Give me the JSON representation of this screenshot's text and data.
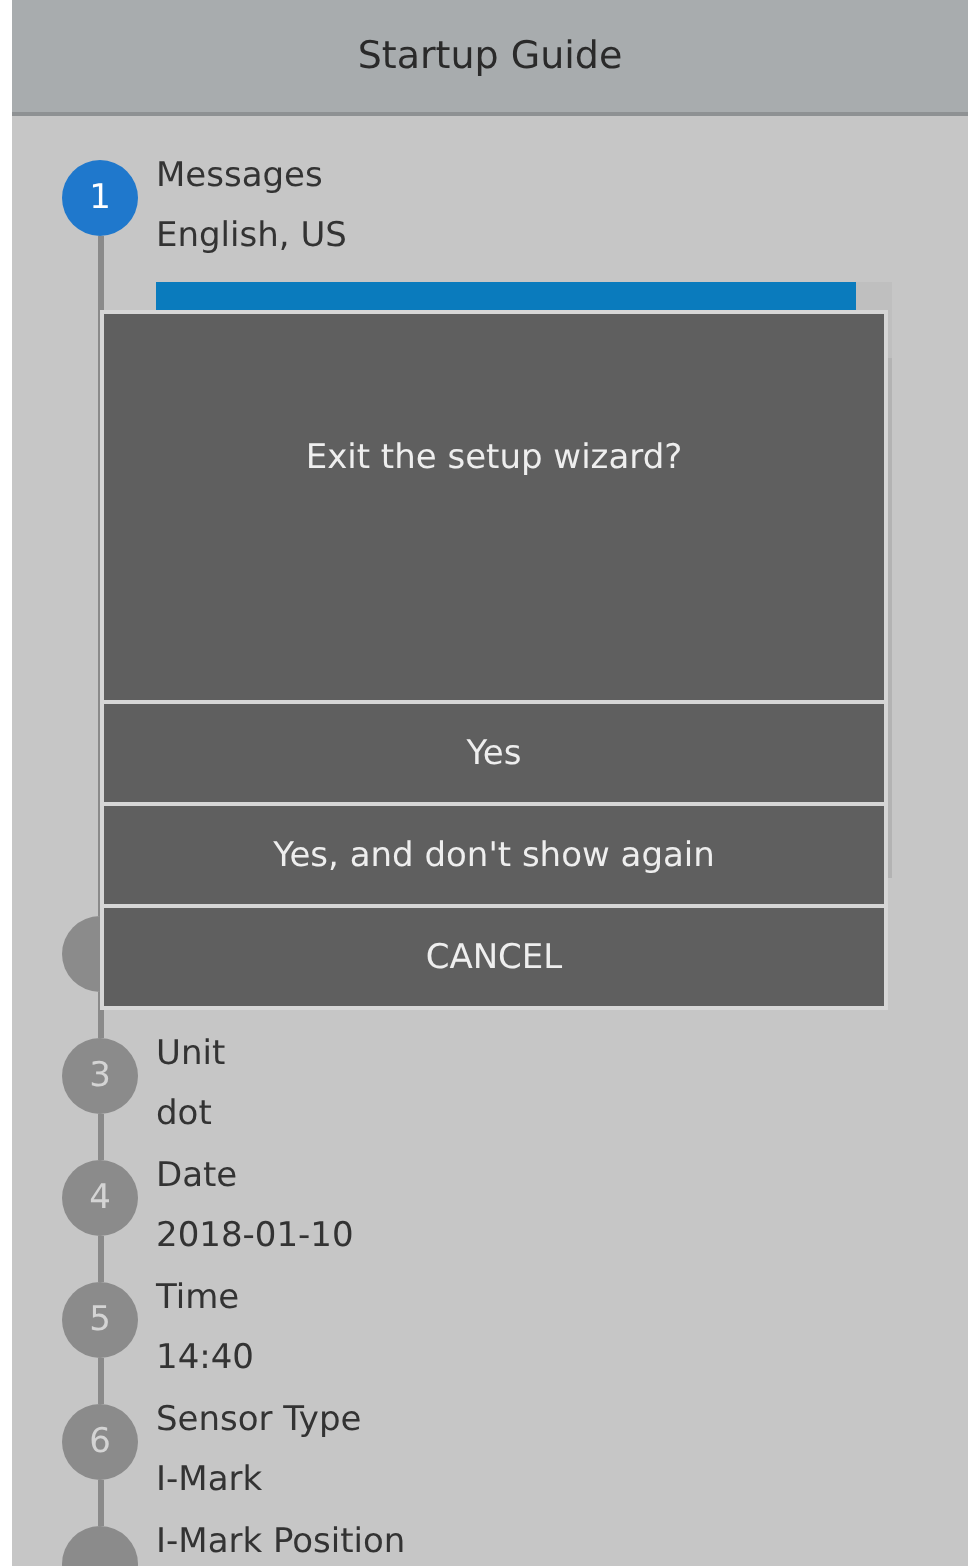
{
  "header": {
    "title": "Startup Guide"
  },
  "steps": [
    {
      "number": "1",
      "title": "Messages",
      "value": "English, US",
      "selected": true,
      "expanded": true,
      "options": [
        {
          "selected": true
        }
      ]
    },
    {
      "selected": false
    },
    {
      "number": "3",
      "title": "Unit",
      "value": "dot",
      "selected": false
    },
    {
      "number": "4",
      "title": "Date",
      "value": "2018-01-10",
      "selected": false
    },
    {
      "number": "5",
      "title": "Time",
      "value": "14:40",
      "selected": false
    },
    {
      "number": "6",
      "title": "Sensor Type",
      "value": "I-Mark",
      "selected": false
    },
    {
      "title": "I-Mark Position",
      "selected": false
    }
  ],
  "dialog": {
    "message": "Exit the setup wizard?",
    "buttons": [
      "Yes",
      "Yes, and don't show again",
      "CANCEL"
    ]
  }
}
